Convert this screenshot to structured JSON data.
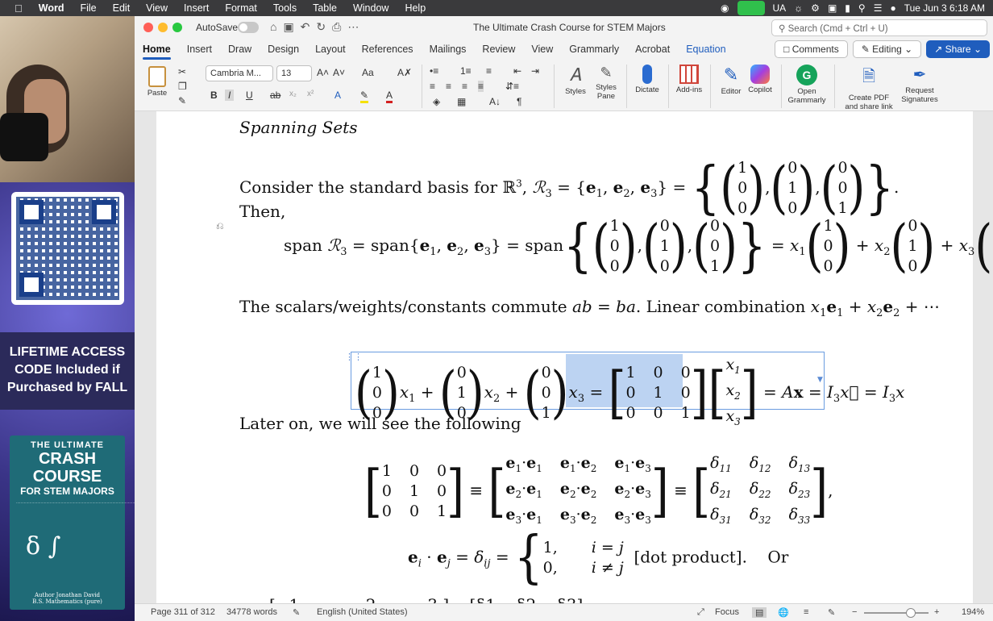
{
  "menubar": {
    "app": "Word",
    "items": [
      "File",
      "Edit",
      "View",
      "Insert",
      "Format",
      "Tools",
      "Table",
      "Window",
      "Help"
    ],
    "input_source": "UA",
    "clock": "Tue Jun 3  6:18 AM"
  },
  "promo": {
    "lifetime_line1": "LIFETIME ACCESS",
    "lifetime_line2": "CODE Included if",
    "lifetime_line3": "Purchased by FALL",
    "book_line1": "THE ULTIMATE",
    "book_line2": "CRASH COURSE",
    "book_line3": "FOR STEM MAJORS",
    "book_author1": "Author Jonathan David",
    "book_author2": "B.S. Mathematics (pure)"
  },
  "titlebar": {
    "autosave": "AutoSave",
    "doc_title": "The Ultimate Crash Course for STEM Majors",
    "search_placeholder": "Search (Cmd + Ctrl + U)"
  },
  "tabs": [
    "Home",
    "Insert",
    "Draw",
    "Design",
    "Layout",
    "References",
    "Mailings",
    "Review",
    "View",
    "Grammarly",
    "Acrobat",
    "Equation"
  ],
  "tab_buttons": {
    "comments": "Comments",
    "editing": "Editing",
    "share": "Share"
  },
  "ribbon": {
    "paste": "Paste",
    "font_name": "Cambria M...",
    "font_size": "13",
    "styles": "Styles",
    "styles_pane_1": "Styles",
    "styles_pane_2": "Pane",
    "dictate": "Dictate",
    "addins": "Add-ins",
    "editor": "Editor",
    "copilot": "Copilot",
    "open_grammarly_1": "Open",
    "open_grammarly_2": "Grammarly",
    "create_pdf_1": "Create PDF",
    "create_pdf_2": "and share link",
    "request_sig_1": "Request",
    "request_sig_2": "Signatures",
    "colors": {
      "highlight": "#f5e10a",
      "font_color": "#d32020",
      "accent": "#1f5dbd"
    }
  },
  "document": {
    "heading": "Spanning Sets",
    "consider": "Consider the standard basis for",
    "then": "Then,",
    "scalars": "The scalars/weights/constants commute",
    "scalars2": ". Linear combination",
    "later": "Later on, we will see the following",
    "dot_product": "[dot product].",
    "or": "Or"
  },
  "statusbar": {
    "page": "Page 311 of 312",
    "words": "34778 words",
    "language": "English (United States)",
    "focus": "Focus",
    "zoom": "194%"
  }
}
